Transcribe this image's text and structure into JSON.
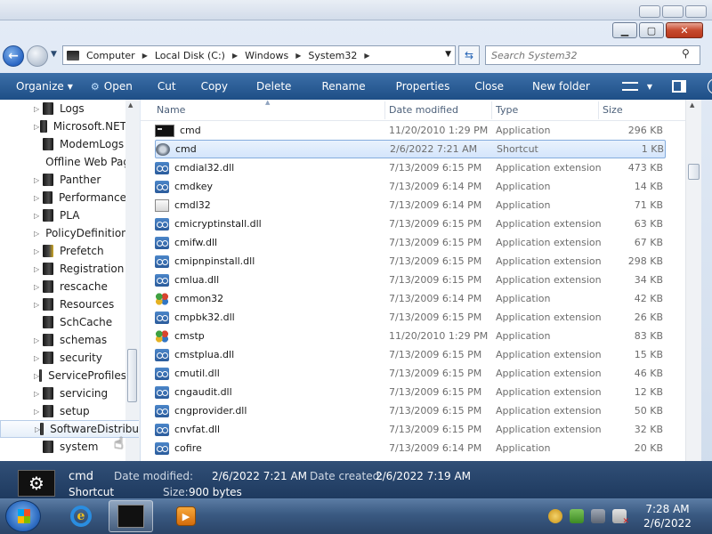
{
  "address": {
    "crumbs": [
      "Computer",
      "Local Disk (C:)",
      "Windows",
      "System32"
    ],
    "search_placeholder": "Search System32"
  },
  "toolbar": {
    "organize": "Organize",
    "open": "Open",
    "cut": "Cut",
    "copy": "Copy",
    "delete": "Delete",
    "rename": "Rename",
    "properties": "Properties",
    "close": "Close",
    "new_folder": "New folder"
  },
  "nav": {
    "items": [
      {
        "label": "Logs",
        "expandable": true
      },
      {
        "label": "Microsoft.NET",
        "expandable": true
      },
      {
        "label": "ModemLogs",
        "expandable": false
      },
      {
        "label": "Offline Web Pages",
        "expandable": false
      },
      {
        "label": "Panther",
        "expandable": true
      },
      {
        "label": "Performance",
        "expandable": true
      },
      {
        "label": "PLA",
        "expandable": true
      },
      {
        "label": "PolicyDefinitions",
        "expandable": true
      },
      {
        "label": "Prefetch",
        "expandable": true
      },
      {
        "label": "Registration",
        "expandable": true
      },
      {
        "label": "rescache",
        "expandable": true
      },
      {
        "label": "Resources",
        "expandable": true
      },
      {
        "label": "SchCache",
        "expandable": false
      },
      {
        "label": "schemas",
        "expandable": true
      },
      {
        "label": "security",
        "expandable": true
      },
      {
        "label": "ServiceProfiles",
        "expandable": true
      },
      {
        "label": "servicing",
        "expandable": true
      },
      {
        "label": "setup",
        "expandable": true
      },
      {
        "label": "SoftwareDistribution",
        "expandable": true
      },
      {
        "label": "system",
        "expandable": false
      }
    ]
  },
  "columns": {
    "name": "Name",
    "date": "Date modified",
    "type": "Type",
    "size": "Size"
  },
  "files": [
    {
      "name": "cmd",
      "date": "11/20/2010 1:29 PM",
      "type": "Application",
      "size": "296 KB",
      "icon": "cmd"
    },
    {
      "name": "cmd",
      "date": "2/6/2022 7:21 AM",
      "type": "Shortcut",
      "size": "1 KB",
      "icon": "gear"
    },
    {
      "name": "cmdial32.dll",
      "date": "7/13/2009 6:15 PM",
      "type": "Application extension",
      "size": "473 KB",
      "icon": "dll"
    },
    {
      "name": "cmdkey",
      "date": "7/13/2009 6:14 PM",
      "type": "Application",
      "size": "14 KB",
      "icon": "dll"
    },
    {
      "name": "cmdl32",
      "date": "7/13/2009 6:14 PM",
      "type": "Application",
      "size": "71 KB",
      "icon": "doc"
    },
    {
      "name": "cmicryptinstall.dll",
      "date": "7/13/2009 6:15 PM",
      "type": "Application extension",
      "size": "63 KB",
      "icon": "dll"
    },
    {
      "name": "cmifw.dll",
      "date": "7/13/2009 6:15 PM",
      "type": "Application extension",
      "size": "67 KB",
      "icon": "dll"
    },
    {
      "name": "cmipnpinstall.dll",
      "date": "7/13/2009 6:15 PM",
      "type": "Application extension",
      "size": "298 KB",
      "icon": "dll"
    },
    {
      "name": "cmlua.dll",
      "date": "7/13/2009 6:15 PM",
      "type": "Application extension",
      "size": "34 KB",
      "icon": "dll"
    },
    {
      "name": "cmmon32",
      "date": "7/13/2009 6:14 PM",
      "type": "Application",
      "size": "42 KB",
      "icon": "cm"
    },
    {
      "name": "cmpbk32.dll",
      "date": "7/13/2009 6:15 PM",
      "type": "Application extension",
      "size": "26 KB",
      "icon": "dll"
    },
    {
      "name": "cmstp",
      "date": "11/20/2010 1:29 PM",
      "type": "Application",
      "size": "83 KB",
      "icon": "cm"
    },
    {
      "name": "cmstplua.dll",
      "date": "7/13/2009 6:15 PM",
      "type": "Application extension",
      "size": "15 KB",
      "icon": "dll"
    },
    {
      "name": "cmutil.dll",
      "date": "7/13/2009 6:15 PM",
      "type": "Application extension",
      "size": "46 KB",
      "icon": "dll"
    },
    {
      "name": "cngaudit.dll",
      "date": "7/13/2009 6:15 PM",
      "type": "Application extension",
      "size": "12 KB",
      "icon": "dll"
    },
    {
      "name": "cngprovider.dll",
      "date": "7/13/2009 6:15 PM",
      "type": "Application extension",
      "size": "50 KB",
      "icon": "dll"
    },
    {
      "name": "cnvfat.dll",
      "date": "7/13/2009 6:15 PM",
      "type": "Application extension",
      "size": "32 KB",
      "icon": "dll"
    },
    {
      "name": "cofire",
      "date": "7/13/2009 6:14 PM",
      "type": "Application",
      "size": "20 KB",
      "icon": "dll"
    }
  ],
  "details": {
    "name": "cmd",
    "kind": "Shortcut",
    "modified_label": "Date modified:",
    "modified_value": "2/6/2022 7:21 AM",
    "created_label": "Date created:",
    "created_value": "2/6/2022 7:19 AM",
    "size_label": "Size:",
    "size_value": "900 bytes"
  },
  "clock": {
    "time": "7:28 AM",
    "date": "2/6/2022"
  }
}
